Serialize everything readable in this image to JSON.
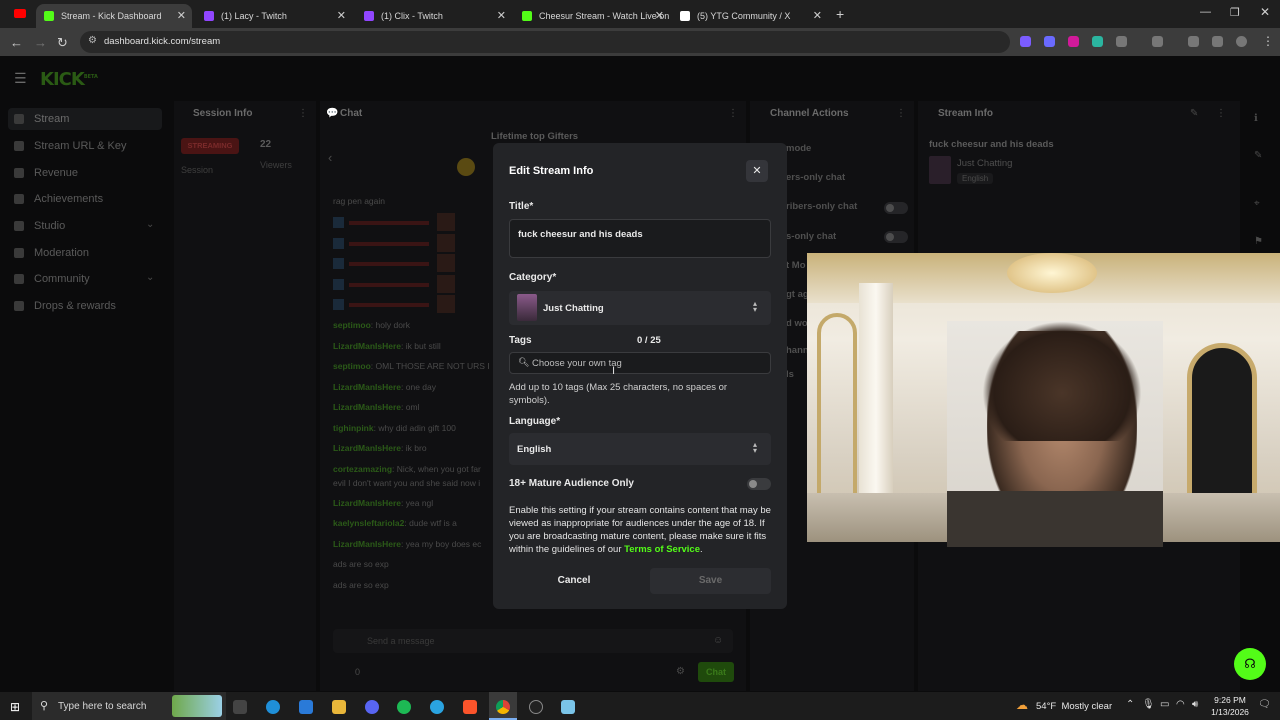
{
  "browser": {
    "tabs": [
      {
        "title": "Stream - Kick Dashboard",
        "active": true,
        "color": "#53fc18"
      },
      {
        "title": "(1) Lacy - Twitch",
        "active": false,
        "color": "#9146ff"
      },
      {
        "title": "(1) Clix - Twitch",
        "active": false,
        "color": "#9146ff"
      },
      {
        "title": "Cheesur Stream - Watch Live on",
        "active": false,
        "color": "#53fc18"
      },
      {
        "title": "(5) YTG Community / X",
        "active": false,
        "color": "#ffffff"
      }
    ],
    "url": "dashboard.kick.com/stream"
  },
  "kick": {
    "logo": "KICK",
    "logo_sup": "BETA",
    "sidebar": [
      {
        "label": "Stream",
        "icon": "stream-icon",
        "active": true
      },
      {
        "label": "Stream URL & Key",
        "icon": "key-icon"
      },
      {
        "label": "Revenue",
        "icon": "revenue-icon"
      },
      {
        "label": "Achievements",
        "icon": "trophy-icon"
      },
      {
        "label": "Studio",
        "icon": "studio-icon",
        "chevron": true
      },
      {
        "label": "Moderation",
        "icon": "shield-icon"
      },
      {
        "label": "Community",
        "icon": "community-icon",
        "chevron": true
      },
      {
        "label": "Drops & rewards",
        "icon": "gift-icon"
      }
    ],
    "panels": {
      "session": {
        "title": "Session Info",
        "badge": "STREAMING",
        "session_label": "Session",
        "viewers": "22",
        "viewers_label": "Viewers"
      },
      "chat": {
        "title": "Chat",
        "gifters": "Lifetime top Gifters",
        "send_placeholder": "Send a message",
        "chat_button": "Chat",
        "count": "0"
      },
      "channel": {
        "title": "Channel Actions",
        "items": [
          "mode",
          "ers-only chat",
          "ribers-only chat",
          "s-only chat",
          "t Mo",
          "gt ag",
          "d wo",
          "hann",
          "ls"
        ]
      },
      "stream": {
        "title": "Stream Info",
        "stream_title": "fuck cheesur and his deads",
        "category": "Just Chatting",
        "language": "English"
      }
    },
    "chat_lines": [
      {
        "user": "",
        "msg": "rag pen again"
      },
      {
        "user": "septimoo",
        "msg": "holy dork"
      },
      {
        "user": "LizardManIsHere",
        "msg": "ik but still"
      },
      {
        "user": "septimoo",
        "msg": "OML THOSE ARE NOT URS I"
      },
      {
        "user": "LizardManIsHere",
        "msg": "one day"
      },
      {
        "user": "LizardManIsHere",
        "msg": "oml"
      },
      {
        "user": "tighinpink",
        "msg": "why did adin gift 100"
      },
      {
        "user": "LizardManIsHere",
        "msg": "ik bro"
      },
      {
        "user": "cortezamazing",
        "msg": "Nick, when you got far"
      },
      {
        "user": "",
        "msg": "evil I don't want you and she said now i"
      },
      {
        "user": "LizardManIsHere",
        "msg": "yea ngl"
      },
      {
        "user": "kaelynsleftariola2",
        "msg": "dude wtf is a"
      },
      {
        "user": "LizardManIsHere",
        "msg": "yea my boy does ec"
      },
      {
        "user": "",
        "msg": "ads are so exp"
      },
      {
        "user": "",
        "msg": "ads are so exp"
      }
    ]
  },
  "modal": {
    "title": "Edit Stream Info",
    "title_label": "Title*",
    "title_value": "fuck cheesur and his deads",
    "category_label": "Category*",
    "category_value": "Just Chatting",
    "tags_label": "Tags",
    "tags_count": "0 / 25",
    "tags_placeholder": "Choose your own tag",
    "tags_help": "Add up to 10 tags (Max 25 characters, no spaces or symbols).",
    "language_label": "Language*",
    "language_value": "English",
    "mature_label": "18+ Mature Audience Only",
    "mature_desc": "Enable this setting if your stream contains content that may be viewed as inappropriate for audiences under the age of 18. If you are broadcasting mature content, please make sure it fits within the guidelines of our",
    "tos_link": "Terms of Service",
    "tos_end": ".",
    "cancel": "Cancel",
    "save": "Save",
    "accent": "#53fc18"
  },
  "taskbar": {
    "search_placeholder": "Type here to search",
    "weather": "54°F  Mostly clear",
    "time": "9:26 PM",
    "date": "1/13/2026"
  }
}
